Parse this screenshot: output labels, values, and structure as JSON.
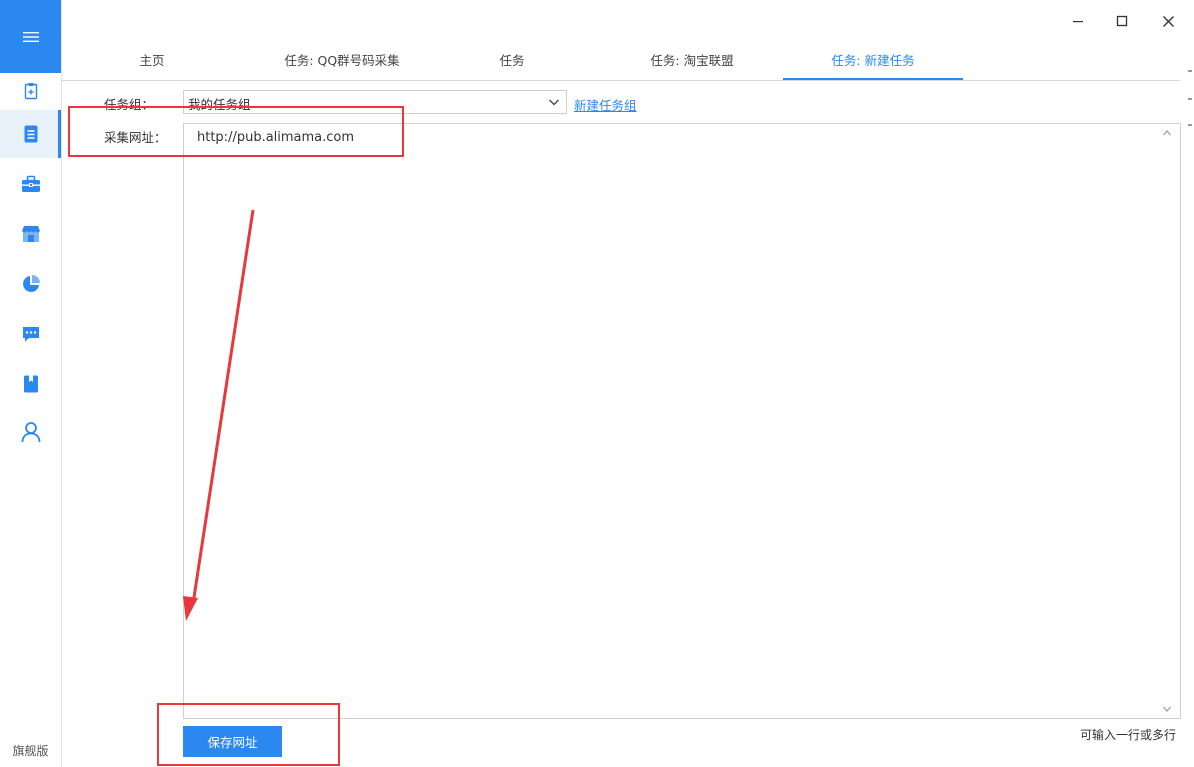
{
  "sidebar": {
    "items": [
      {
        "icon": "clipboard-plus-icon"
      },
      {
        "icon": "document-icon",
        "active": true
      },
      {
        "icon": "briefcase-icon"
      },
      {
        "icon": "store-icon"
      },
      {
        "icon": "pie-chart-icon"
      },
      {
        "icon": "chat-icon"
      },
      {
        "icon": "book-icon"
      },
      {
        "icon": "user-icon"
      }
    ],
    "edition_label": "旗舰版"
  },
  "tabs": [
    {
      "label": "主页"
    },
    {
      "label": "任务: QQ群号码采集"
    },
    {
      "label": "任务"
    },
    {
      "label": "任务: 淘宝联盟"
    },
    {
      "label": "任务: 新建任务",
      "active": true
    }
  ],
  "form": {
    "task_group_label": "任务组：",
    "task_group_value": "我的任务组",
    "new_group_link": "新建任务组",
    "url_label": "采集网址：",
    "url_value": "http://pub.alimama.com",
    "save_button": "保存网址",
    "hint": "可输入一行或多行"
  },
  "colors": {
    "accent": "#2b88f0",
    "annotation_red": "#e8383d"
  }
}
